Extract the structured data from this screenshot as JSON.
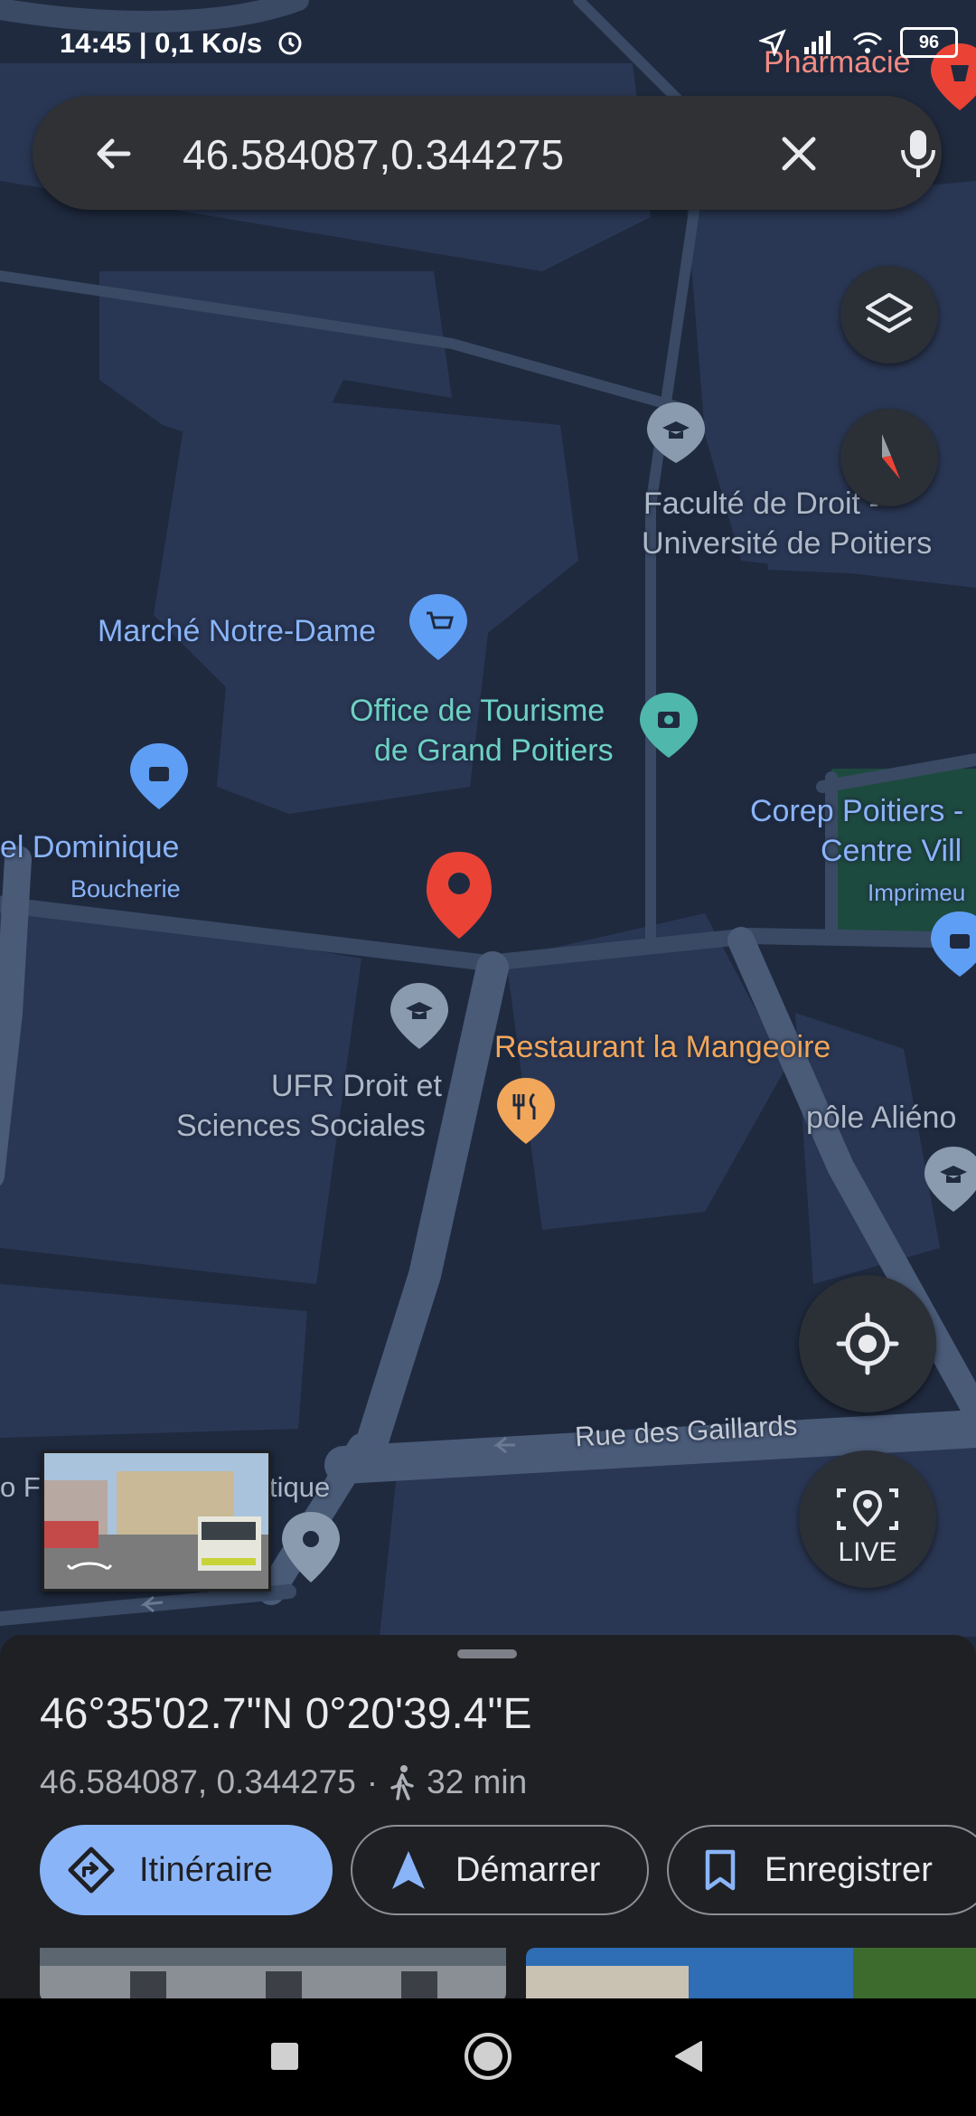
{
  "status_bar": {
    "time": "14:45 | 0,1 Ko/s",
    "battery": "96",
    "icons": [
      "alarm-icon",
      "location-arrow-icon",
      "signal-icon",
      "wifi-icon",
      "battery-icon"
    ]
  },
  "search": {
    "query": "46.584087,0.344275",
    "back_icon": "arrow-left-icon",
    "clear_icon": "close-icon",
    "mic_icon": "microphone-icon"
  },
  "map": {
    "labels": {
      "pharmacie": "Pharmacie",
      "faculte_line1": "Faculté de Droit -",
      "faculte_line2": "Université de Poitiers",
      "marche": "Marché Notre-Dame",
      "office_line1": "Office de Tourisme",
      "office_line2": "de Grand Poitiers",
      "corep_line1": "Corep Poitiers -",
      "corep_line2": "Centre Vill",
      "imprimerie": "Imprimeu",
      "dominique": "el Dominique",
      "boucherie": "Boucherie",
      "restaurant": "Restaurant la Mangeoire",
      "ufr_line1": "UFR Droit et",
      "ufr_line2": "Sciences Sociales",
      "pole": "pôle Aliéno",
      "rue_gaillards": "Rue des Gaillards",
      "fo": "o Fo",
      "tique": "tique"
    },
    "colors": {
      "background": "#1f2a3f",
      "block": "#2a3754",
      "road": "#3a4a64",
      "main_road": "#4a5b78",
      "pin_red": "#ea4335",
      "poi_blue": "#5e9ff5",
      "poi_teal": "#4fb7ac",
      "poi_orange": "#f2a65a",
      "poi_grey": "#8a9bb0",
      "park": "#1d4a3e"
    }
  },
  "controls": {
    "layers_icon": "layers-icon",
    "compass_icon": "compass-icon",
    "my_location_icon": "my-location-icon",
    "live_label": "LIVE",
    "live_icon": "live-view-icon"
  },
  "sheet": {
    "dms": "46°35'02.7\"N 0°20'39.4\"E",
    "decimal": "46.584087, 0.344275",
    "separator": "·",
    "walk_time": "32 min",
    "buttons": {
      "directions": "Itinéraire",
      "start": "Démarrer",
      "save": "Enregistrer"
    }
  },
  "navbar": {
    "icons": [
      "recents-square-icon",
      "home-circle-icon",
      "back-triangle-icon"
    ]
  }
}
